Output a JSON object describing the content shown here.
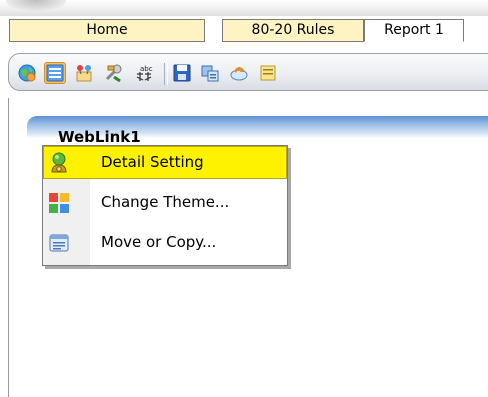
{
  "tabs": [
    {
      "label": "Home"
    },
    {
      "label": "80-20 Rules"
    },
    {
      "label": "Report 1"
    }
  ],
  "toolbar": {
    "icons": [
      {
        "name": "globe-icon"
      },
      {
        "name": "list-view-icon"
      },
      {
        "name": "pin-board-icon"
      },
      {
        "name": "tools-icon"
      },
      {
        "name": "spell-check-icon"
      },
      {
        "name": "save-icon"
      },
      {
        "name": "copy-report-icon"
      },
      {
        "name": "share-icon"
      },
      {
        "name": "notes-icon"
      }
    ],
    "selected": "list-view-icon"
  },
  "panel": {
    "title": "WebLink1"
  },
  "context_menu": {
    "items": [
      {
        "label": "Detail Setting",
        "icon": "settings-person-icon",
        "highlighted": true
      },
      {
        "label": "Change Theme...",
        "icon": "color-palette-icon",
        "highlighted": false
      },
      {
        "label": "Move or Copy...",
        "icon": "move-copy-icon",
        "highlighted": false
      }
    ]
  },
  "colors": {
    "tab_background": "#fdf3c3",
    "menu_highlight": "#fff200",
    "panel_header_blue": "#5e90d0",
    "toolbar_selected": "#f4c15b"
  }
}
